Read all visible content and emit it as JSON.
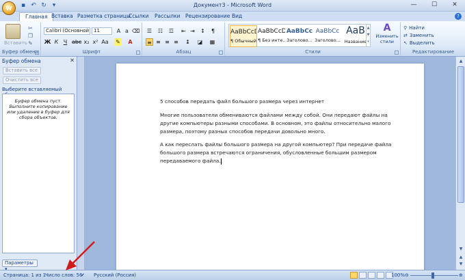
{
  "app": {
    "title": "Документ3 - Microsoft Word",
    "office_button_label": "W"
  },
  "quick_access": [
    "save-icon",
    "undo-icon",
    "redo-icon",
    "customize-icon"
  ],
  "tabs": [
    {
      "label": "Главная",
      "active": true
    },
    {
      "label": "Вставка"
    },
    {
      "label": "Разметка страницы"
    },
    {
      "label": "Ссылки"
    },
    {
      "label": "Рассылки"
    },
    {
      "label": "Рецензирование"
    },
    {
      "label": "Вид"
    }
  ],
  "ribbon": {
    "clipboard": {
      "label": "Буфер обмена",
      "paste": "Вставить"
    },
    "font": {
      "label": "Шрифт",
      "name": "Calibri (Основной те",
      "size": "11"
    },
    "paragraph": {
      "label": "Абзац"
    },
    "styles": {
      "label": "Стили",
      "items": [
        {
          "sample": "AaBbCcDc",
          "name": "¶ Обычный",
          "selected": true
        },
        {
          "sample": "AaBbCcDc",
          "name": "¶ Без инте..."
        },
        {
          "sample": "AaBbCc",
          "name": "Заголово..."
        },
        {
          "sample": "AaBbCc",
          "name": "Заголово..."
        },
        {
          "sample": "AaB",
          "name": "Название"
        }
      ],
      "change_styles": "Изменить стили"
    },
    "editing": {
      "label": "Редактирование",
      "find": "Найти",
      "replace": "Заменить",
      "select": "Выделить"
    }
  },
  "clipboard_pane": {
    "title": "Буфер обмена",
    "paste_all": "Вставить все",
    "clear_all": "Очистить все",
    "select_label": "Выберите вставляемый объект:",
    "empty_text": "Буфер обмена пуст. Выполните копирование или удаление в буфер для сбора объектов.",
    "options": "Параметры"
  },
  "document": {
    "paragraphs": [
      "5 способов передать файл большого размера через интернет",
      "Многие пользователи обмениваются файлами между собой. Они передают файлы на другие компьютеры разными способами. В основном, это файлы относительно малого размера, поэтому разных способов передачи довольно много.",
      "А как переслать файлы большого размера на другой компьютер? При передаче файла большого размера встречаются ограничения, обусловленные большим размером передаваемого файла."
    ]
  },
  "status": {
    "page": "Страница: 1 из 1",
    "words": "Число слов: 56",
    "language": "Русский (Россия)",
    "zoom": "100%"
  },
  "colors": {
    "ribbon_text": "#15428b",
    "annotation_arrow": "#d11a1a"
  }
}
